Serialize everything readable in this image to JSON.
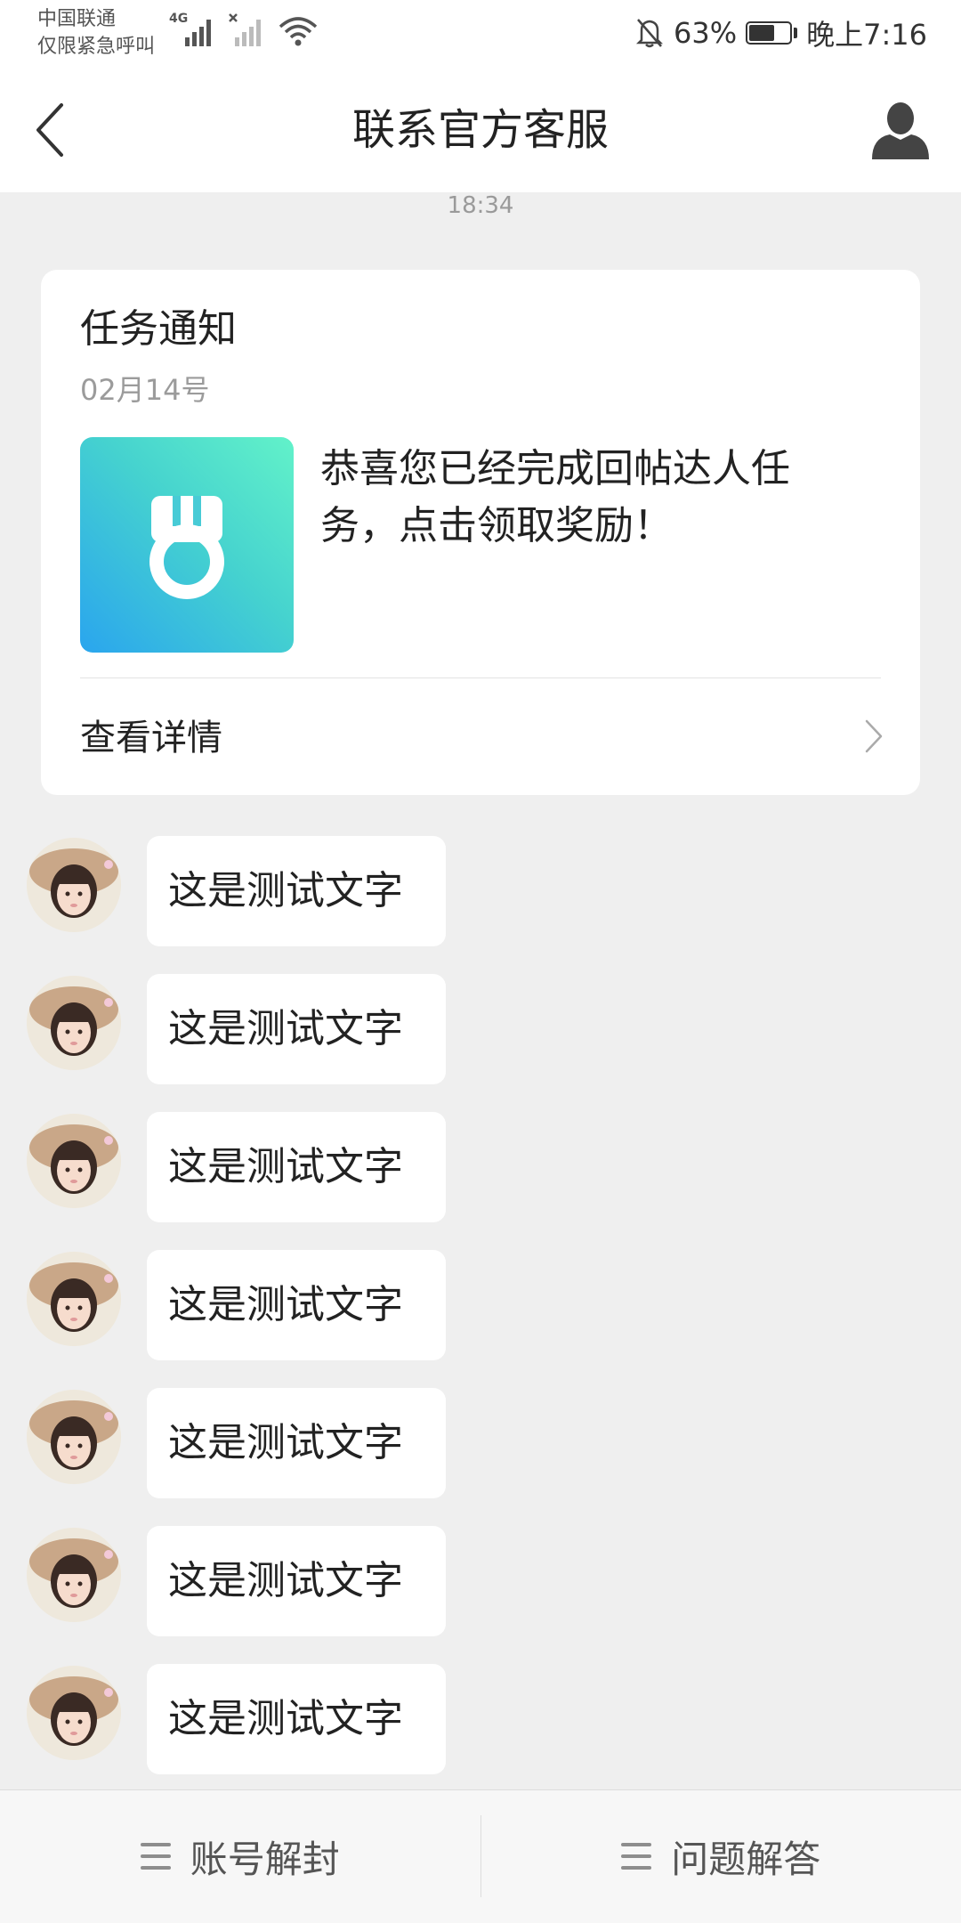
{
  "status_bar": {
    "carrier_line1": "中国联通",
    "carrier_line2": "仅限紧急呼叫",
    "network_label": "4G",
    "battery_percent": "63%",
    "battery_level": 0.63,
    "time": "晚上7:16"
  },
  "nav": {
    "title": "联系官方客服",
    "back_icon": "chevron-left-icon",
    "profile_icon": "person-icon"
  },
  "chat": {
    "timestamp": "18:34",
    "notice_card": {
      "title": "任务通知",
      "date": "02月14号",
      "image_icon": "medal-icon",
      "message": "恭喜您已经完成回帖达人任务，点击领取奖励！",
      "link_label": "查看详情"
    },
    "messages": [
      {
        "text": "这是测试文字"
      },
      {
        "text": "这是测试文字"
      },
      {
        "text": "这是测试文字"
      },
      {
        "text": "这是测试文字"
      },
      {
        "text": "这是测试文字"
      },
      {
        "text": "这是测试文字"
      },
      {
        "text": "这是测试文字"
      }
    ]
  },
  "bottom_bar": {
    "buttons": [
      {
        "label": "账号解封",
        "icon": "menu-icon"
      },
      {
        "label": "问题解答",
        "icon": "menu-icon"
      }
    ]
  },
  "colors": {
    "background": "#efefef",
    "card": "#ffffff",
    "medal_gradient_start": "#2aa5ee",
    "medal_gradient_end": "#62f2c9"
  }
}
